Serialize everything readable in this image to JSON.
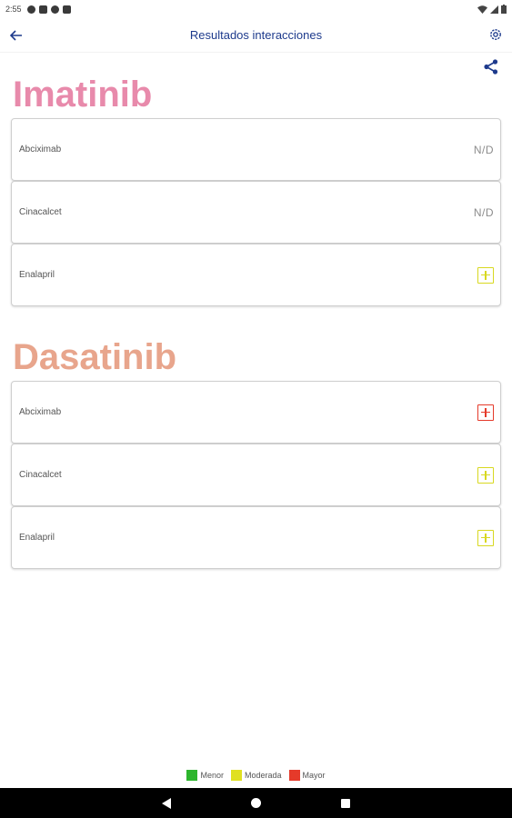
{
  "status_bar": {
    "time": "2:55",
    "icons": [
      "notification-a-icon",
      "notification-b-icon",
      "notification-c-icon",
      "sim-icon"
    ],
    "right_icons": [
      "wifi-icon",
      "signal-icon",
      "battery-icon"
    ]
  },
  "app_bar": {
    "title": "Resultados interacciones",
    "back_icon": "arrow-left-icon",
    "settings_icon": "gear-icon",
    "accent_color": "#1d3a8c"
  },
  "share_icon": "share-icon",
  "groups": [
    {
      "drug": "Imatinib",
      "color": "#e88aab",
      "interactions": [
        {
          "name": "Abciximab",
          "value": "N/D",
          "severity": null
        },
        {
          "name": "Cinacalcet",
          "value": "N/D",
          "severity": null
        },
        {
          "name": "Enalapril",
          "value": "",
          "severity": "Moderada"
        }
      ]
    },
    {
      "drug": "Dasatinib",
      "color": "#e8a58c",
      "interactions": [
        {
          "name": "Abciximab",
          "value": "",
          "severity": "Mayor"
        },
        {
          "name": "Cinacalcet",
          "value": "",
          "severity": "Moderada"
        },
        {
          "name": "Enalapril",
          "value": "",
          "severity": "Moderada"
        }
      ]
    }
  ],
  "legend": [
    {
      "label": "Menor",
      "color": "#2db52d"
    },
    {
      "label": "Moderada",
      "color": "#e0e020"
    },
    {
      "label": "Mayor",
      "color": "#e53a2a"
    }
  ],
  "nav_bar": {
    "buttons": [
      "back-triangle-icon",
      "home-circle-icon",
      "recents-square-icon"
    ]
  }
}
